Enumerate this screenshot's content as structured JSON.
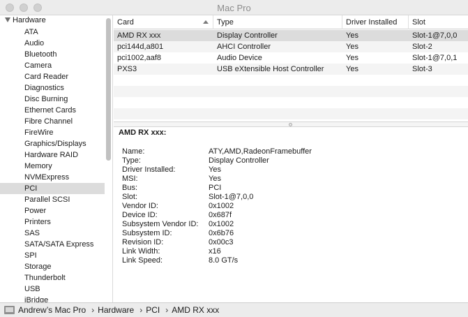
{
  "window": {
    "title": "Mac Pro"
  },
  "sidebar": {
    "group": "Hardware",
    "items": [
      "ATA",
      "Audio",
      "Bluetooth",
      "Camera",
      "Card Reader",
      "Diagnostics",
      "Disc Burning",
      "Ethernet Cards",
      "Fibre Channel",
      "FireWire",
      "Graphics/Displays",
      "Hardware RAID",
      "Memory",
      "NVMExpress",
      "PCI",
      "Parallel SCSI",
      "Power",
      "Printers",
      "SAS",
      "SATA/SATA Express",
      "SPI",
      "Storage",
      "Thunderbolt",
      "USB",
      "iBridge"
    ],
    "selected": "PCI"
  },
  "table": {
    "columns": [
      "Card",
      "Type",
      "Driver Installed",
      "Slot"
    ],
    "rows": [
      {
        "card": "AMD RX xxx",
        "type": "Display Controller",
        "driver": "Yes",
        "slot": "Slot-1@7,0,0"
      },
      {
        "card": "pci144d,a801",
        "type": "AHCI Controller",
        "driver": "Yes",
        "slot": "Slot-2"
      },
      {
        "card": "pci1002,aaf8",
        "type": "Audio Device",
        "driver": "Yes",
        "slot": "Slot-1@7,0,1"
      },
      {
        "card": "PXS3",
        "type": "USB eXtensible Host Controller",
        "driver": "Yes",
        "slot": "Slot-3"
      }
    ]
  },
  "detail": {
    "title": "AMD RX xxx:",
    "fields": [
      {
        "key": "Name:",
        "value": "ATY,AMD,RadeonFramebuffer"
      },
      {
        "key": "Type:",
        "value": "Display Controller"
      },
      {
        "key": "Driver Installed:",
        "value": "Yes"
      },
      {
        "key": "MSI:",
        "value": "Yes"
      },
      {
        "key": "Bus:",
        "value": "PCI"
      },
      {
        "key": "Slot:",
        "value": "Slot-1@7,0,0"
      },
      {
        "key": "Vendor ID:",
        "value": "0x1002"
      },
      {
        "key": "Device ID:",
        "value": "0x687f"
      },
      {
        "key": "Subsystem Vendor ID:",
        "value": "0x1002"
      },
      {
        "key": "Subsystem ID:",
        "value": "0x6b76"
      },
      {
        "key": "Revision ID:",
        "value": "0x00c3"
      },
      {
        "key": "Link Width:",
        "value": "x16"
      },
      {
        "key": "Link Speed:",
        "value": "8.0 GT/s"
      }
    ]
  },
  "pathbar": {
    "crumbs": [
      "Andrew’s Mac Pro",
      "Hardware",
      "PCI",
      "AMD RX xxx"
    ],
    "separator": "›"
  }
}
